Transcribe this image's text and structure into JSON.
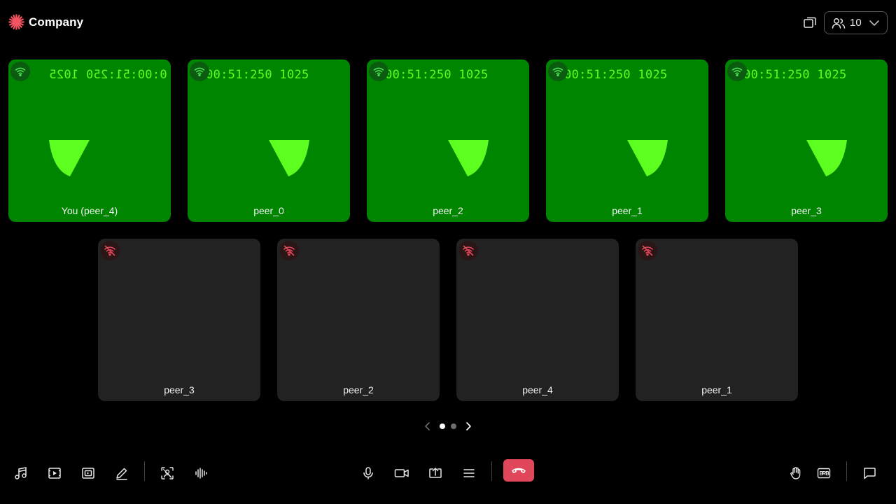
{
  "header": {
    "brand_name": "Company",
    "brand_color": "#f25461",
    "pip_icon": "picture-in-picture-icon",
    "participants": {
      "icon": "people-icon",
      "count": "10",
      "chevron_icon": "chevron-down-icon"
    }
  },
  "colors": {
    "video_tile": "#008500",
    "video_overlay": "#5cff1f",
    "empty_tile": "#222222",
    "connected": "#4ade50",
    "disconnected": "#e0475a",
    "end_call": "#e0475a"
  },
  "page1": {
    "row1": [
      {
        "name": "You (peer_4)",
        "timecode": "0:00:51:250 1025",
        "mirrored": true,
        "network": "wifi-icon"
      },
      {
        "name": "peer_0",
        "timecode": "0:00:51:250 1025",
        "mirrored": false,
        "network": "wifi-icon"
      },
      {
        "name": "peer_2",
        "timecode": "0:00:51:250 1025",
        "mirrored": false,
        "network": "wifi-icon"
      },
      {
        "name": "peer_1",
        "timecode": "0:00:51:250 1025",
        "mirrored": false,
        "network": "wifi-icon"
      },
      {
        "name": "peer_3",
        "timecode": "0:00:51:250 1025",
        "mirrored": false,
        "network": "wifi-icon"
      }
    ],
    "row2": [
      {
        "name": "peer_3",
        "network": "wifi-off-icon"
      },
      {
        "name": "peer_2",
        "network": "wifi-off-icon"
      },
      {
        "name": "peer_4",
        "network": "wifi-off-icon"
      },
      {
        "name": "peer_1",
        "network": "wifi-off-icon"
      }
    ]
  },
  "pagination": {
    "pages": 2,
    "current": 1
  },
  "footer": {
    "left": [
      "music-icon",
      "play-video-icon",
      "media-icon",
      "whiteboard-pen-icon",
      "virtual-background-icon",
      "noise-suppression-icon"
    ],
    "center": [
      "microphone-icon",
      "camera-icon",
      "screenshare-icon",
      "more-menu-icon",
      "end-call-icon"
    ],
    "right": [
      "raise-hand-icon",
      "brb-icon",
      "chat-icon"
    ]
  }
}
